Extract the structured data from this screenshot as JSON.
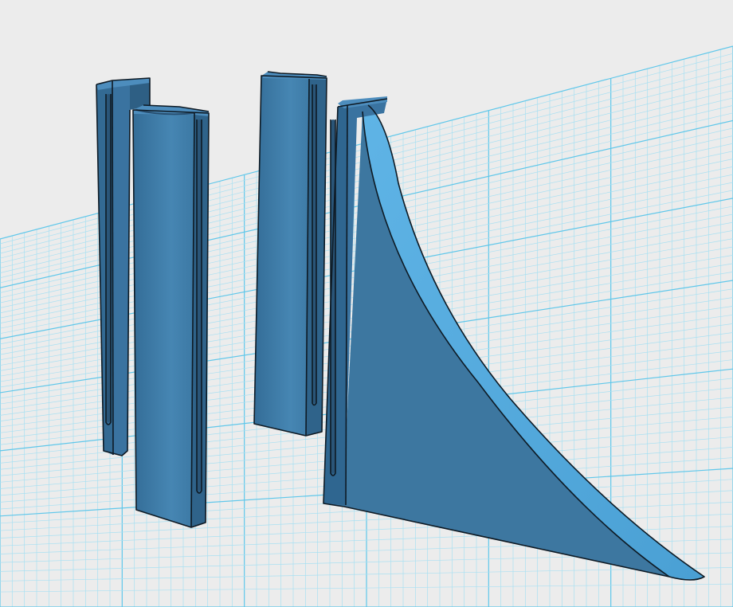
{
  "app": {
    "view": "3d-viewport"
  },
  "workplane": {
    "grid_color_fine": "#a9e0f2",
    "grid_color_major": "#5fc7ea",
    "background": "#ececec"
  },
  "parts": [
    {
      "name": "short-slotted-post",
      "color": "#3e79a3"
    },
    {
      "name": "channel-post",
      "color": "#3e79a3"
    },
    {
      "name": "flat-post",
      "color": "#3e79a3"
    },
    {
      "name": "fin-with-slotted-post",
      "color": "#3e79a3"
    }
  ]
}
